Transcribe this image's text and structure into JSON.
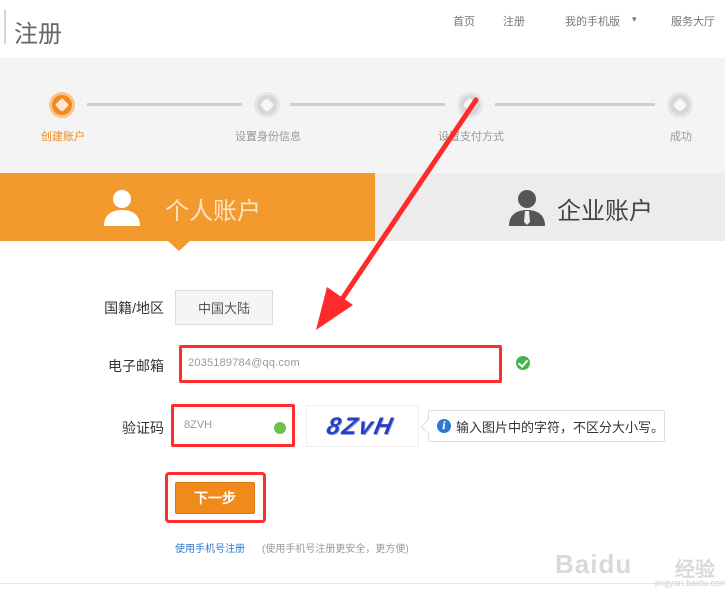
{
  "header": {
    "title": "注册",
    "nav": [
      "首页",
      "注册",
      "我的手机版",
      "服务大厅"
    ]
  },
  "steps": [
    {
      "label": "创建账户",
      "active": true
    },
    {
      "label": "设置身份信息",
      "active": false
    },
    {
      "label": "设置支付方式",
      "active": false
    },
    {
      "label": "成功",
      "active": false
    }
  ],
  "tabs": {
    "personal": "个人账户",
    "company": "企业账户"
  },
  "form": {
    "country_label": "国籍/地区",
    "country_value": "中国大陆",
    "email_label": "电子邮箱",
    "email_value": "2035189784@qq.com",
    "captcha_label": "验证码",
    "captcha_value": "8ZVH",
    "captcha_image_text": "8ZvH",
    "captcha_hint": "输入图片中的字符，不区分大小写。",
    "next_button": "下一步"
  },
  "footer": {
    "link": "使用手机号注册",
    "note": "(使用手机号注册更安全，更方便)"
  },
  "watermark": {
    "brand": "Baidu",
    "jy": "经验",
    "url": "jingyan.baidu.com"
  },
  "colors": {
    "accent": "#f08a1c",
    "highlight": "#ff2d2d",
    "ok": "#44b549"
  }
}
